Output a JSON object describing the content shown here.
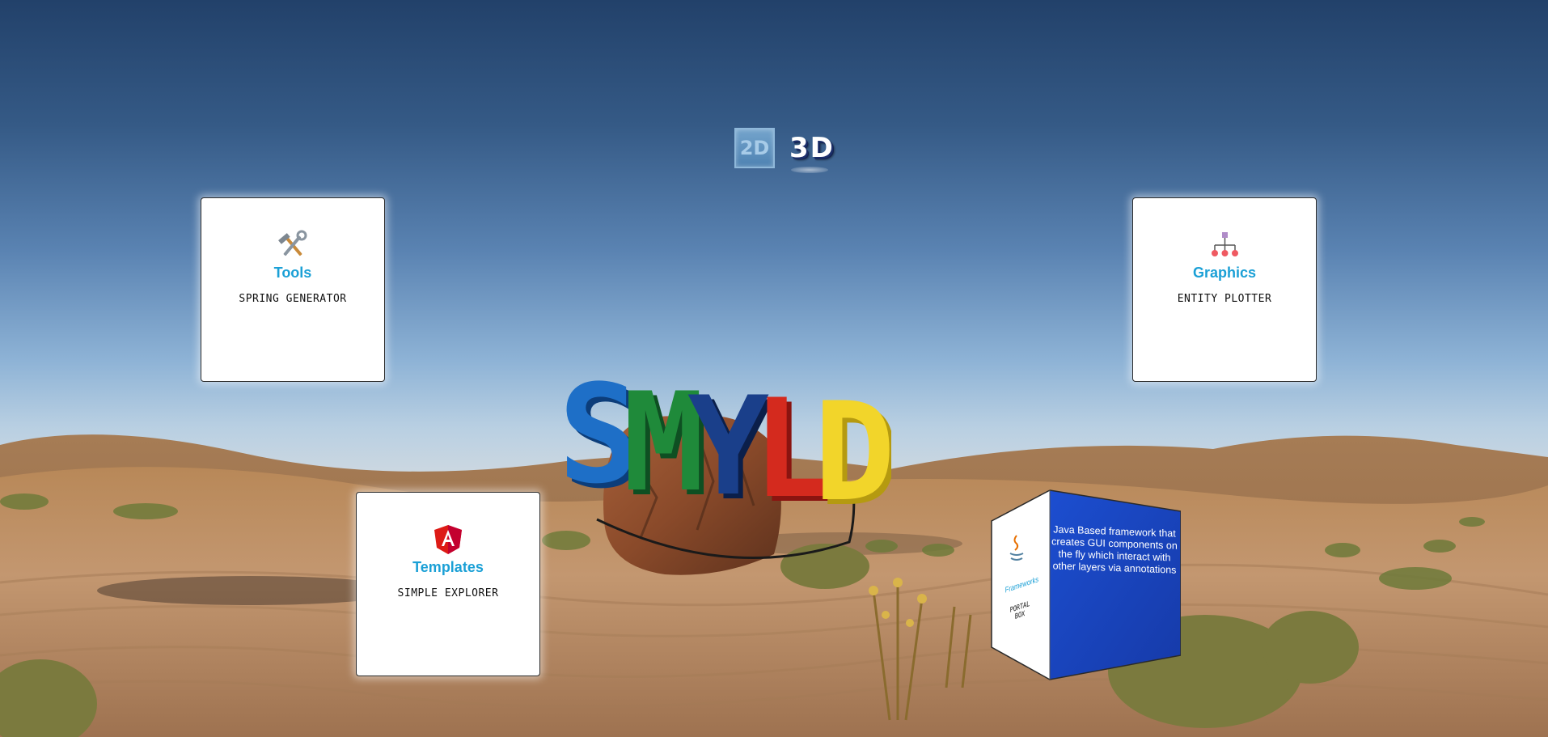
{
  "view_toggle": {
    "option_2d": "2D",
    "option_3d": "3D",
    "active": "3D"
  },
  "logo": {
    "text": "SMYLD",
    "letters": [
      {
        "char": "S",
        "color": "#1e6fc7"
      },
      {
        "char": "M",
        "color": "#1f8a3a"
      },
      {
        "char": "Y",
        "color": "#1a3f8a"
      },
      {
        "char": "L",
        "color": "#d42a1e"
      },
      {
        "char": "D",
        "color": "#f2d52a"
      }
    ]
  },
  "cards": {
    "tools": {
      "icon": "hammer-wrench-icon",
      "title": "Tools",
      "subtitle": "SPRING GENERATOR"
    },
    "graphics": {
      "icon": "hierarchy-icon",
      "title": "Graphics",
      "subtitle": "ENTITY PLOTTER"
    },
    "templates": {
      "icon": "angular-icon",
      "title": "Templates",
      "subtitle": "SIMPLE EXPLORER"
    },
    "frameworks": {
      "icon": "java-icon",
      "title": "Frameworks",
      "subtitle": "PORTAL BOX",
      "description": "Java Based framework that creates GUI components on the fly which interact with other layers via annotations"
    }
  },
  "colors": {
    "accent": "#1ba0d6",
    "cube_face": "#1a44c4",
    "card_background": "#ffffff"
  }
}
